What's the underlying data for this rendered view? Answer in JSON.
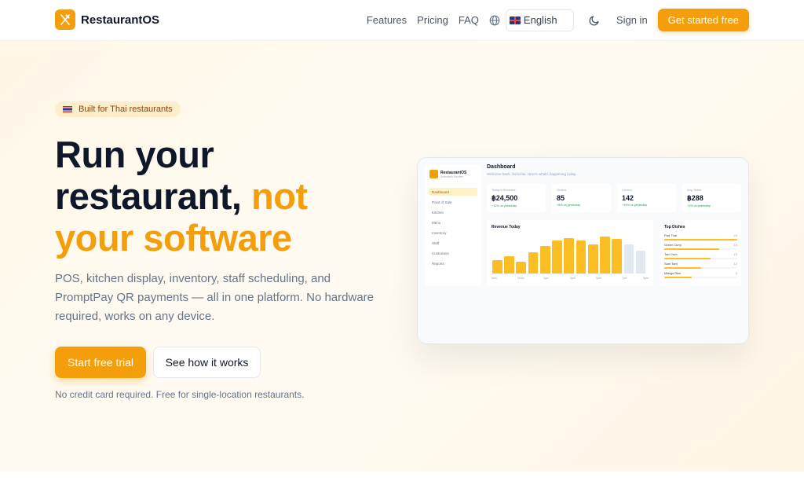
{
  "header": {
    "brand": "RestaurantOS",
    "nav": [
      "Features",
      "Pricing",
      "FAQ"
    ],
    "language": "English",
    "sign_in": "Sign in",
    "cta": "Get started free"
  },
  "hero": {
    "badge": "Built for Thai restaurants",
    "headline_line1": "Run your",
    "headline_line2_dark": "restaurant,",
    "headline_line2_accent": "not",
    "headline_line3": "your software",
    "subtitle": "POS, kitchen display, inventory, staff scheduling, and PromptPay QR payments — all in one platform. No hardware required, works on any device.",
    "primary_button": "Start free trial",
    "secondary_button": "See how it works",
    "note": "No credit card required. Free for single-location restaurants."
  },
  "preview": {
    "brand": "RestaurantOS",
    "brand_sub": "Somchai's Kitchen",
    "menu": [
      "Dashboard",
      "Point of Sale",
      "Kitchen",
      "Menu",
      "Inventory",
      "Staff",
      "Customers",
      "Reports"
    ],
    "title": "Dashboard",
    "welcome": "Welcome back, Somchai. Here's what's happening today.",
    "stats": [
      {
        "label": "Today's Revenue",
        "value": "฿24,500",
        "delta": "+12% vs yesterday"
      },
      {
        "label": "Orders",
        "value": "85",
        "delta": "+8% vs yesterday"
      },
      {
        "label": "Covers",
        "value": "142",
        "delta": "+15% vs yesterday"
      },
      {
        "label": "Avg Ticket",
        "value": "฿288",
        "delta": "+3% vs yesterday"
      }
    ],
    "revenue_title": "Revenue Today",
    "revenue_x_ticks": [
      "9am",
      "11am",
      "1pm",
      "3pm",
      "5pm",
      "7pm",
      "9pm"
    ],
    "top_dishes_title": "Top Dishes",
    "top_dishes": [
      {
        "name": "Pad Thai",
        "count": "24",
        "share": 1.0
      },
      {
        "name": "Green Curry",
        "count": "18",
        "share": 0.75
      },
      {
        "name": "Tom Yum",
        "count": "15",
        "share": 0.63
      },
      {
        "name": "Som Tam",
        "count": "12",
        "share": 0.5
      },
      {
        "name": "Mango Rice",
        "count": "9",
        "share": 0.38
      }
    ]
  },
  "chart_data": {
    "type": "bar",
    "title": "Revenue Today",
    "categories": [
      "9am",
      "10am",
      "11am",
      "12pm",
      "1pm",
      "2pm",
      "3pm",
      "4pm",
      "5pm",
      "6pm",
      "7pm",
      "8pm",
      "9pm"
    ],
    "values": [
      35,
      45,
      30,
      55,
      70,
      85,
      90,
      85,
      75,
      95,
      88,
      75,
      58
    ],
    "future_from_index": 11,
    "colors": {
      "past": "#fbbf24",
      "future": "#e2e8f0"
    }
  },
  "colors": {
    "accent": "#f59e0b",
    "dark": "#0f172a",
    "muted": "#64748b"
  }
}
